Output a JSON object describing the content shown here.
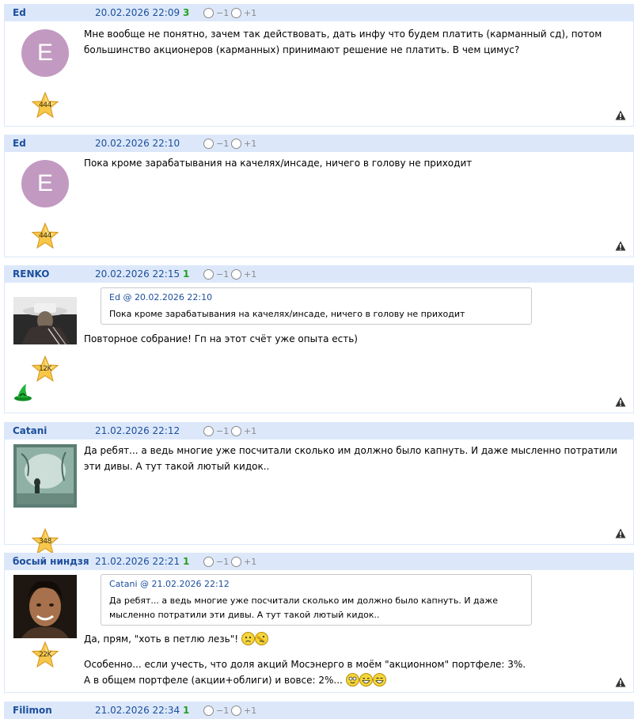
{
  "vote": {
    "minus_label": "−1",
    "plus_label": "+1"
  },
  "posts": [
    {
      "author": "Ed",
      "date": "20.02.2026 22:09",
      "score": "3",
      "avatar_letter": "E",
      "rank": "444",
      "text": "Мне вообще не понятно, зачем так действовать, дать инфу что будем платить (карманный сд), потом большинство акционеров (карманных) принимают решение не платить. В чем цимус?"
    },
    {
      "author": "Ed",
      "date": "20.02.2026 22:10",
      "score": "",
      "avatar_letter": "E",
      "rank": "444",
      "text": "Пока кроме зарабатывания на качелях/инсаде, ничего в голову не приходит"
    },
    {
      "author": "RENKO",
      "date": "20.02.2026 22:15",
      "score": "1",
      "rank": "12K",
      "quote": {
        "author": "Ed",
        "at": "@",
        "date": "20.02.2026 22:10",
        "text": "Пока кроме зарабатывания на качелях/инсаде, ничего в голову не приходит"
      },
      "text": "Повторное собрание! Гп на этот счёт уже опыта есть)"
    },
    {
      "author": "Catani",
      "date": "21.02.2026 22:12",
      "score": "",
      "rank": "348",
      "text": "Да ребят... а ведь многие уже посчитали сколько им должно было капнуть. И даже мысленно потратили эти дивы. А тут такой лютый кидок.."
    },
    {
      "author": "босый ниндзя",
      "date": "21.02.2026 22:21",
      "score": "1",
      "rank": "22K",
      "quote": {
        "author": "Catani",
        "at": "@",
        "date": "21.02.2026 22:12",
        "text": "Да ребят... а ведь многие уже посчитали сколько им должно было капнуть. И даже мысленно потратили эти дивы. А тут такой лютый кидок.."
      },
      "text_line1": "Да, прям, \"хоть в петлю лезь\"!",
      "text_line2": "Особенно... если учесть, что доля акций Мосэнерго в моём \"акционном\" портфеле: 3%.",
      "text_line3": "А в общем портфеле (акции+облиги) и вовсе: 2%..."
    },
    {
      "author": "Filimon",
      "date": "21.02.2026 22:34",
      "score": "1"
    }
  ]
}
